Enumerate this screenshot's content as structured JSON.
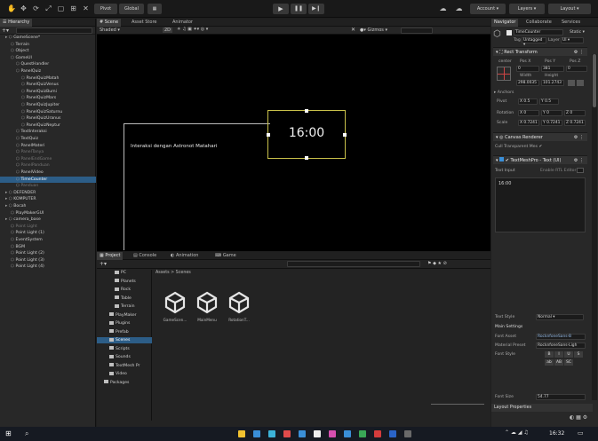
{
  "toolbar": {
    "pivot_label": "Pivot",
    "global_label": "Global",
    "account_label": "Account",
    "layers_label": "Layers",
    "layout_label": "Layout",
    "play_icon": "play-icon",
    "pause_icon": "pause-icon",
    "step_icon": "step-icon"
  },
  "hierarchy": {
    "tab_label": "Hierarchy",
    "items": [
      {
        "label": "GameScene*",
        "indent": 0
      },
      {
        "label": "Terrain",
        "indent": 1
      },
      {
        "label": "Object",
        "indent": 1
      },
      {
        "label": "GameUI",
        "indent": 1
      },
      {
        "label": "QuestHandler",
        "indent": 2
      },
      {
        "label": "PanelQuiz",
        "indent": 2
      },
      {
        "label": "PanelQuizMatah",
        "indent": 3
      },
      {
        "label": "PanelQuizVenus",
        "indent": 3
      },
      {
        "label": "PanelQuizBumi",
        "indent": 3
      },
      {
        "label": "PanelQuizMars",
        "indent": 3
      },
      {
        "label": "PanelQuizJupiter",
        "indent": 3
      },
      {
        "label": "PanelQuizSaturnu",
        "indent": 3
      },
      {
        "label": "PanelQuizUranus",
        "indent": 3
      },
      {
        "label": "PanelQuizNeptur",
        "indent": 3
      },
      {
        "label": "TextInteraksi",
        "indent": 2
      },
      {
        "label": "TextQuiz",
        "indent": 2
      },
      {
        "label": "PanelMateri",
        "indent": 2
      },
      {
        "label": "PanelTanya",
        "indent": 2,
        "dim": true
      },
      {
        "label": "PanelEndGame",
        "indent": 2,
        "dim": true
      },
      {
        "label": "PanelPanduan",
        "indent": 2,
        "dim": true
      },
      {
        "label": "PanelVideo",
        "indent": 2
      },
      {
        "label": "TimeCounter",
        "indent": 2,
        "selected": true
      },
      {
        "label": "Panduan",
        "indent": 2,
        "dim": true
      },
      {
        "label": "DEFENDER",
        "indent": 0
      },
      {
        "label": "KOMPUTER",
        "indent": 0
      },
      {
        "label": "Bocah",
        "indent": 0
      },
      {
        "label": "PlayMakerGUI",
        "indent": 1
      },
      {
        "label": "camera_base",
        "indent": 0
      },
      {
        "label": "Point Light",
        "indent": 1,
        "dim": true
      },
      {
        "label": "Point Light (1)",
        "indent": 1
      },
      {
        "label": "EventSystem",
        "indent": 1
      },
      {
        "label": "BGM",
        "indent": 1
      },
      {
        "label": "Point Light (2)",
        "indent": 1
      },
      {
        "label": "Point Light (3)",
        "indent": 1
      },
      {
        "label": "Point Light (4)",
        "indent": 1
      }
    ]
  },
  "scene": {
    "tabs": [
      "Scene",
      "Asset Store",
      "Animator"
    ],
    "shaded_label": "Shaded",
    "twod_label": "2D",
    "gizmos_label": "Gizmos",
    "timer_text": "16:00",
    "interaction_text": "Interaksi dengan Astronot Matahari"
  },
  "project": {
    "tabs": [
      "Project",
      "Console",
      "Animation",
      "Game"
    ],
    "breadcrumb": "Assets > Scenes",
    "tree": [
      {
        "label": "PC",
        "indent": 1
      },
      {
        "label": "Planets",
        "indent": 1
      },
      {
        "label": "Rock",
        "indent": 1
      },
      {
        "label": "Table",
        "indent": 1
      },
      {
        "label": "Terrain",
        "indent": 1
      },
      {
        "label": "PlayMaker",
        "indent": 0
      },
      {
        "label": "Plugins",
        "indent": 0
      },
      {
        "label": "Prefab",
        "indent": 0
      },
      {
        "label": "Scenes",
        "indent": 0,
        "selected": true
      },
      {
        "label": "Scripts",
        "indent": 0
      },
      {
        "label": "Sounds",
        "indent": 0
      },
      {
        "label": "TextMesh Pr",
        "indent": 0
      },
      {
        "label": "Video",
        "indent": 0
      },
      {
        "label": "Packages",
        "indent": -1
      }
    ],
    "assets": [
      "GameScen...",
      "MainMenu",
      "RotationT..."
    ]
  },
  "inspector": {
    "tabs": [
      "Navigator",
      "Collaborate",
      "Services"
    ],
    "object_name": "TimeCounter",
    "static_label": "Static",
    "tag_label": "Tag",
    "tag_value": "Untagged",
    "layer_label": "Layer",
    "layer_value": "UI",
    "rect_transform": {
      "title": "Rect Transform",
      "anchor_label": "center",
      "pos_x_label": "Pos X",
      "pos_y_label": "Pos Y",
      "pos_z_label": "Pos Z",
      "pos_x": "0",
      "pos_y": "381",
      "pos_z": "0",
      "width_label": "Width",
      "height_label": "Height",
      "width": "298.0035",
      "height": "101.2743",
      "anchors_label": "Anchors",
      "pivot_label": "Pivot",
      "pivot_x": "X 0.5",
      "pivot_y": "Y 0.5",
      "rotation_label": "Rotation",
      "rot_x": "X 0",
      "rot_y": "Y 0",
      "rot_z": "Z 0",
      "scale_label": "Scale",
      "scale_x": "X 0.7241",
      "scale_y": "Y 0.7241",
      "scale_z": "Z 0.7241"
    },
    "canvas_renderer": {
      "title": "Canvas Renderer",
      "cull_label": "Cull Transparent Mes"
    },
    "tmp": {
      "title": "TextMeshPro - Text (UI)",
      "text_input_label": "Text Input",
      "enable_rtl_label": "Enable RTL Editor",
      "text_value": "16:00",
      "text_style_label": "Text Style",
      "text_style_value": "Normal",
      "main_settings_label": "Main Settings",
      "font_asset_label": "Font Asset",
      "font_asset_value": "RocknfoneSans-B",
      "material_preset_label": "Material Preset",
      "material_preset_value": "RocknfoneSans-Ligh",
      "font_style_label": "Font Style",
      "font_style_buttons": [
        "B",
        "I",
        "U",
        "S",
        "ab",
        "AB",
        "SC"
      ],
      "font_size_label": "Font Size",
      "font_size_value": "54.77"
    },
    "layout_properties_label": "Layout Properties"
  },
  "taskbar": {
    "clock": "16:32"
  },
  "colors": {
    "accent_blue": "#2c5d87",
    "timer_outline": "#c8c04a",
    "error_red": "#d43c3c"
  }
}
